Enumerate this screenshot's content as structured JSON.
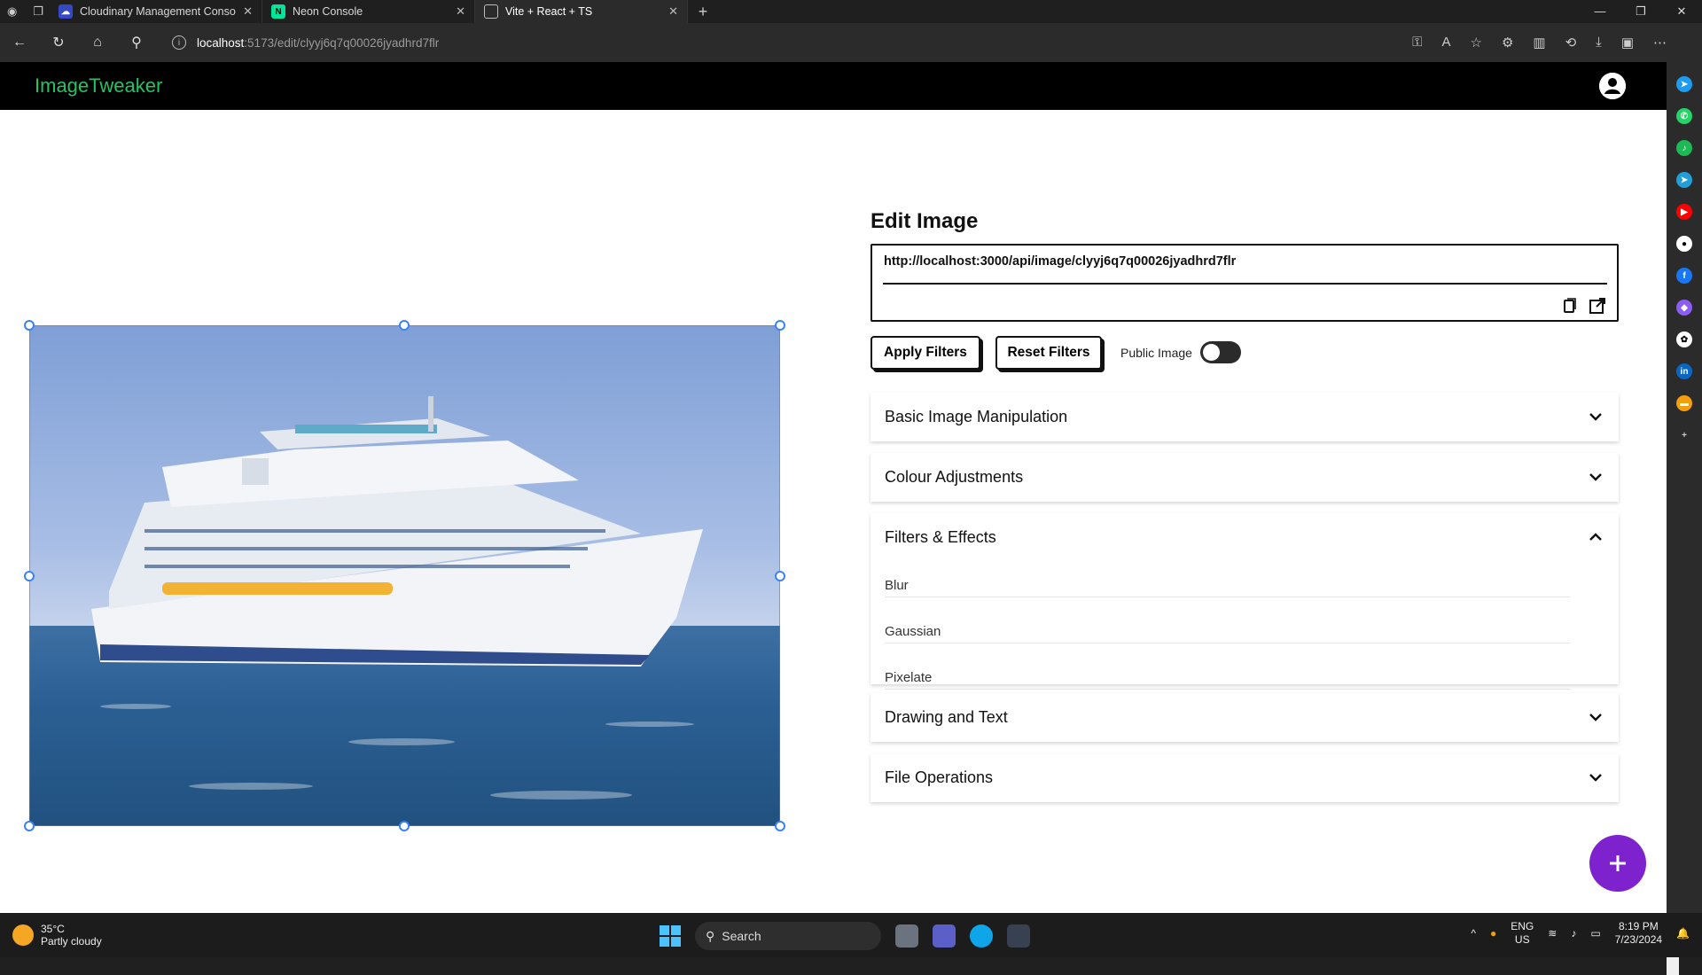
{
  "browser": {
    "tabs": [
      {
        "title": "Cloudinary Management Console",
        "active": false,
        "icon": "cloudinary-icon",
        "color": "#3448c5"
      },
      {
        "title": "Neon Console",
        "active": false,
        "icon": "neon-icon",
        "color": "#00e599"
      },
      {
        "title": "Vite + React + TS",
        "active": true,
        "icon": "page-icon",
        "color": "#9a9a9a"
      }
    ],
    "url_host": "localhost",
    "url_path": ":5173/edit/clyyj6q7q00026jyadhrd7flr"
  },
  "app": {
    "brand": "ImageTweaker",
    "brand_color": "#22c55e",
    "page_title": "Edit Image",
    "image_url": "http://localhost:3000/api/image/clyyj6q7q00026jyadhrd7flr",
    "apply_filters": "Apply Filters",
    "reset_filters": "Reset Filters",
    "public_image_label": "Public Image",
    "public_image_on": false,
    "accordions": [
      {
        "title": "Basic Image Manipulation",
        "expanded": false
      },
      {
        "title": "Colour Adjustments",
        "expanded": false
      },
      {
        "title": "Filters & Effects",
        "expanded": true,
        "items": [
          "Blur",
          "Gaussian",
          "Pixelate"
        ]
      },
      {
        "title": "Drawing and Text",
        "expanded": false
      },
      {
        "title": "File Operations",
        "expanded": false
      }
    ],
    "fab_color": "#7e22ce",
    "canvas_color": "#dcaa67"
  },
  "taskbar": {
    "temperature": "35°C",
    "weather": "Partly cloudy",
    "search_placeholder": "Search",
    "lang_top": "ENG",
    "lang_bottom": "US",
    "time": "8:19 PM",
    "date": "7/23/2024"
  }
}
